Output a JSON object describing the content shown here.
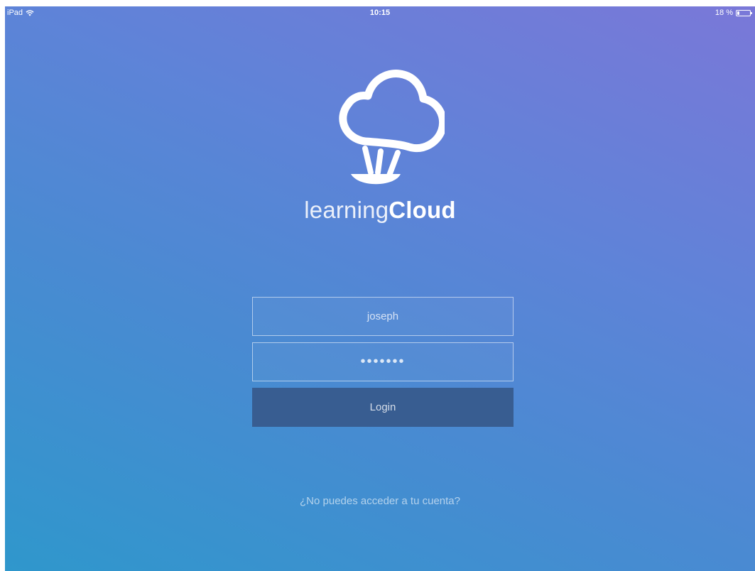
{
  "status_bar": {
    "device": "iPad",
    "time": "10:15",
    "battery": "18 %",
    "battery_level_percent": 18
  },
  "brand": {
    "name_light": "learning",
    "name_bold": "Cloud",
    "logo_icon": "cloud-balloon-icon"
  },
  "login_form": {
    "username_value": "joseph",
    "password_mask": "•••••••",
    "login_label": "Login"
  },
  "forgot_account": "¿No puedes acceder a tu cuenta?",
  "colors": {
    "gradient_start": "#2f97cc",
    "gradient_end": "#7a78d8",
    "login_button": "#385d91",
    "text": "#ffffff"
  }
}
